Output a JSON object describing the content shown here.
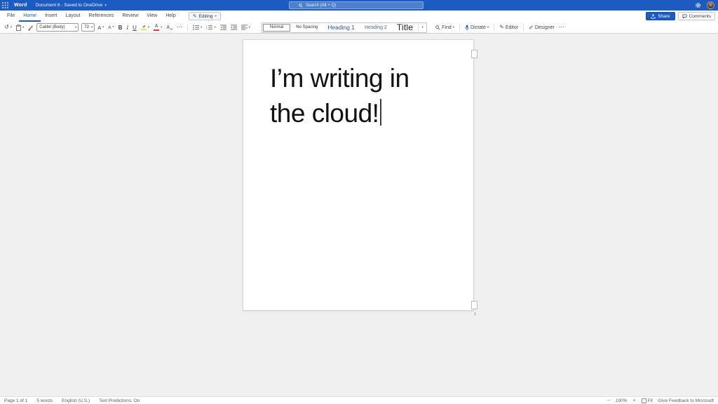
{
  "colors": {
    "brand_blue": "#1C5CC2",
    "accent_blue": "#1A5DBE",
    "heading_blue": "#2F5496",
    "highlight_yellow": "#F7E34D",
    "font_color_red": "#E03C31"
  },
  "icons": {
    "chevron_down": "▾",
    "caret_up": "▴",
    "overflow": "⋯",
    "undo": "↺",
    "pencil": "✎",
    "designer_pen": "✐",
    "minus": "−",
    "plus": "+"
  },
  "header": {
    "app_name": "Word",
    "doc_title": "Document 6 - Saved to OneDrive",
    "search_placeholder": "Search (Alt + Q)"
  },
  "menu": {
    "items": [
      "File",
      "Home",
      "Insert",
      "Layout",
      "References",
      "Review",
      "View",
      "Help"
    ],
    "active_item": "Home",
    "editing_label": "Editing",
    "share_label": "Share",
    "comments_label": "Comments"
  },
  "ribbon": {
    "font_name": "Calibri (Body)",
    "font_size": "72",
    "grow_letter": "A",
    "shrink_letter": "A",
    "bold_label": "B",
    "italic_label": "I",
    "underline_label": "U",
    "font_color_letter": "A",
    "clear_format_letter": "A",
    "styles": [
      "Normal",
      "No Spacing",
      "Heading 1",
      "Heading 2",
      "Title"
    ],
    "find_label": "Find",
    "dictate_label": "Dictate",
    "editor_label": "Editor",
    "designer_label": "Designer"
  },
  "document": {
    "line1": "I’m writing in",
    "line2": "the cloud!"
  },
  "status": {
    "page_info": "Page 1 of 1",
    "word_count": "5 words",
    "language": "English (U.S.)",
    "predictions": "Text Predictions: On",
    "zoom_level": "100%",
    "fit_label": "Fit",
    "feedback": "Give Feedback to Microsoft"
  }
}
